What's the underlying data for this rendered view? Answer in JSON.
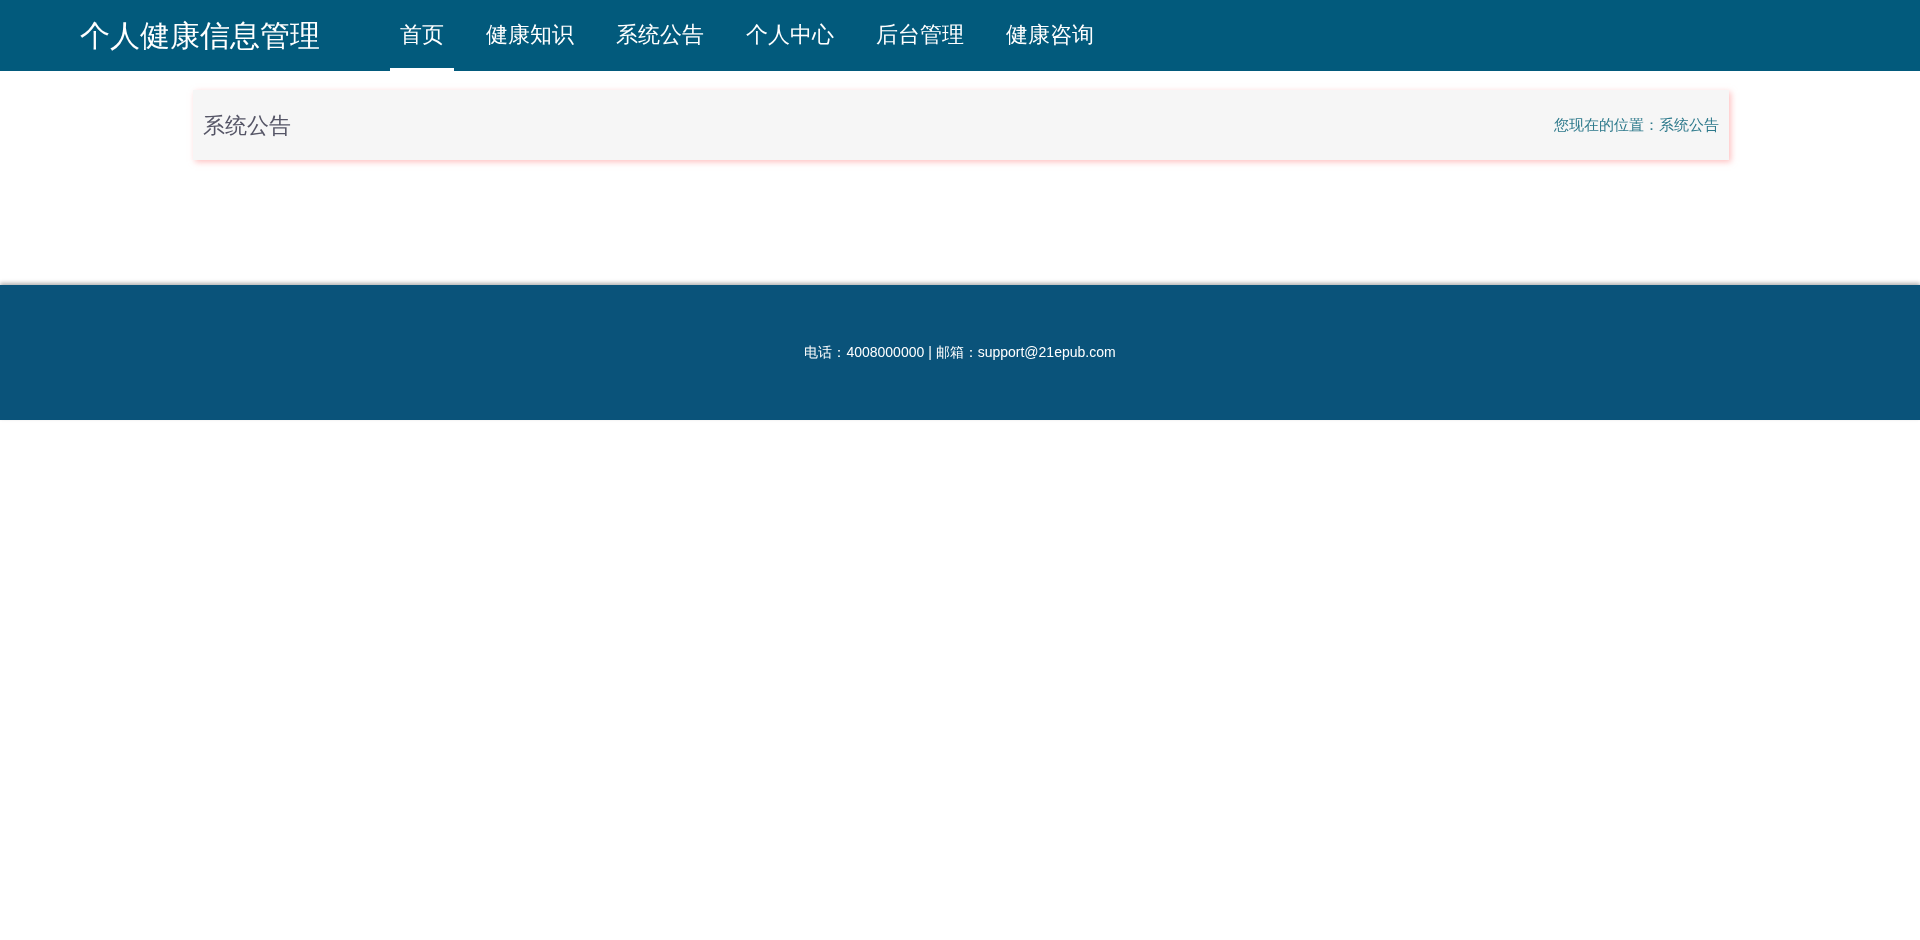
{
  "header": {
    "title": "个人健康信息管理",
    "nav": [
      {
        "label": "首页",
        "selected": true
      },
      {
        "label": "健康知识",
        "selected": false
      },
      {
        "label": "系统公告",
        "selected": false
      },
      {
        "label": "个人中心",
        "selected": false
      },
      {
        "label": "后台管理",
        "selected": false
      },
      {
        "label": "健康咨询",
        "selected": false
      }
    ]
  },
  "page_header": {
    "title": "系统公告",
    "breadcrumb": "您现在的位置：系统公告"
  },
  "footer": {
    "contact": "电话：4008000000 | 邮箱：support@21epub.com"
  }
}
